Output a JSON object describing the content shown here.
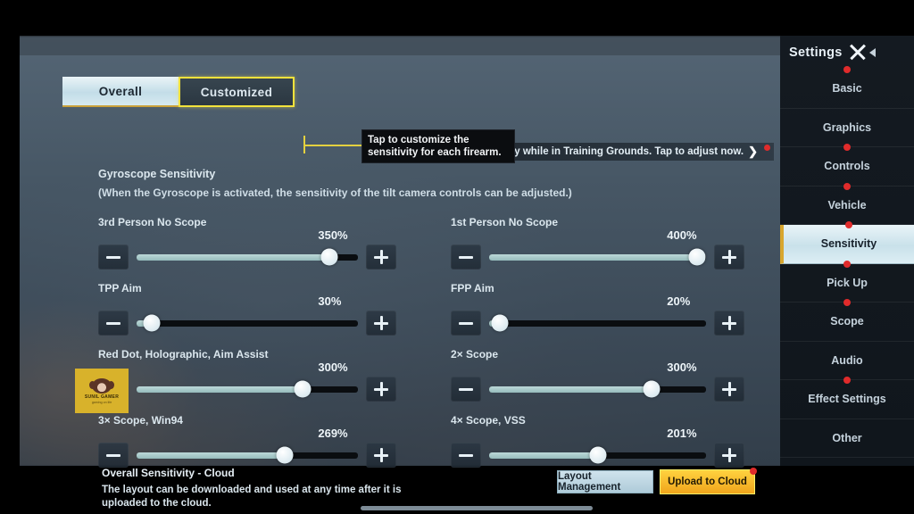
{
  "tabs": [
    {
      "label": "Overall",
      "state": "active"
    },
    {
      "label": "Customized",
      "state": "highlighted"
    }
  ],
  "tooltip": {
    "text": "Tap to customize the sensitivity for each firearm."
  },
  "banner": {
    "text": "Adjust sensitivity easily while in Training Grounds. Tap to adjust now.",
    "chevron": "❯"
  },
  "section": {
    "title": "Gyroscope Sensitivity",
    "description": "(When the Gyroscope is activated, the sensitivity of the tilt camera controls can be adjusted.)"
  },
  "sliders": [
    {
      "label": "3rd Person No Scope",
      "value": "350%",
      "percent": 87
    },
    {
      "label": "1st Person No Scope",
      "value": "400%",
      "percent": 96
    },
    {
      "label": "TPP Aim",
      "value": "30%",
      "percent": 7
    },
    {
      "label": "FPP Aim",
      "value": "20%",
      "percent": 5
    },
    {
      "label": "Red Dot, Holographic, Aim Assist",
      "value": "300%",
      "percent": 75
    },
    {
      "label": "2× Scope",
      "value": "300%",
      "percent": 75
    },
    {
      "label": "3× Scope, Win94",
      "value": "269%",
      "percent": 67
    },
    {
      "label": "4× Scope, VSS",
      "value": "201%",
      "percent": 50
    }
  ],
  "stepper": {
    "minus_label": "minus-icon",
    "plus_label": "plus-icon"
  },
  "cloud": {
    "title": "Overall Sensitivity - Cloud",
    "description": "The layout can be downloaded and used at any time after it is uploaded to the cloud.",
    "layout_button": "Layout Management",
    "upload_button": "Upload to Cloud"
  },
  "sidebar": {
    "title": "Settings",
    "items": [
      {
        "label": "Basic",
        "dot": true,
        "active": false
      },
      {
        "label": "Graphics",
        "dot": false,
        "active": false
      },
      {
        "label": "Controls",
        "dot": true,
        "active": false
      },
      {
        "label": "Vehicle",
        "dot": true,
        "active": false
      },
      {
        "label": "Sensitivity",
        "dot": true,
        "active": true
      },
      {
        "label": "Pick Up",
        "dot": true,
        "active": false
      },
      {
        "label": "Scope",
        "dot": true,
        "active": false
      },
      {
        "label": "Audio",
        "dot": false,
        "active": false
      },
      {
        "label": "Effect Settings",
        "dot": true,
        "active": false
      },
      {
        "label": "Other",
        "dot": false,
        "active": false
      }
    ]
  },
  "watermark": {
    "name": "SUNIL GAMER",
    "tagline": "gaming on life"
  },
  "colors": {
    "accent_yellow": "#f2e23c",
    "upload_yellow": "#ffd23f",
    "slider_fill": "#bcd8d8",
    "notification_red": "#e02b2b",
    "active_tab_bg": "#d6eaf1"
  }
}
